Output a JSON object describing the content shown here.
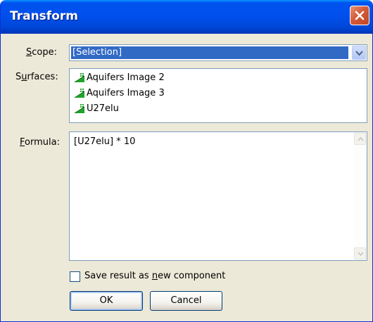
{
  "window": {
    "title": "Transform"
  },
  "form": {
    "scope_label": "Scope:",
    "scope_accesskey": "S",
    "scope_rest": "cope:",
    "scope_value": "[Selection]",
    "surfaces_label_pre": "S",
    "surfaces_accesskey": "u",
    "surfaces_label_post": "rfaces:",
    "surfaces": [
      {
        "name": "Aquifers Image 2",
        "icon": "surface-icon"
      },
      {
        "name": "Aquifers Image 3",
        "icon": "surface-icon"
      },
      {
        "name": "U27elu",
        "icon": "surface-icon"
      }
    ],
    "formula_accesskey": "F",
    "formula_label_rest": "ormula:",
    "formula_value": "[U27elu] * 10",
    "save_checkbox_checked": false,
    "save_label_pre": "Save result as ",
    "save_accesskey": "n",
    "save_label_post": "ew component"
  },
  "buttons": {
    "ok": "OK",
    "cancel": "Cancel"
  },
  "colors": {
    "titlebar": "#0053ee",
    "selection": "#316ac5",
    "close_button": "#d45a38"
  }
}
